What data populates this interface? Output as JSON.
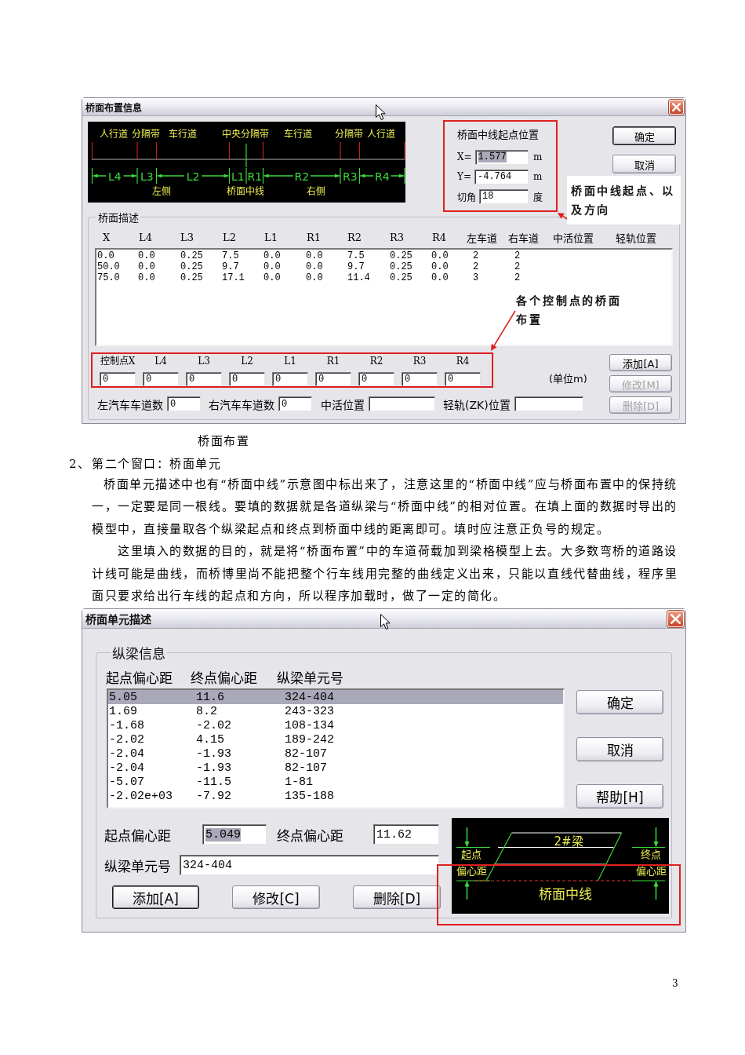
{
  "dialog_1": {
    "title": "桥面布置信息",
    "diagram": {
      "top_labels": [
        "人行道",
        "分隔带",
        "车行道",
        "中央分隔带",
        "车行道",
        "分隔带",
        "人行道"
      ],
      "dimension_labels": [
        "L4",
        "L3",
        "L2",
        "L1",
        "R1",
        "R2",
        "R3",
        "R4"
      ],
      "bottom_labels": [
        "左侧",
        "桥面中线",
        "右侧"
      ]
    },
    "origin": {
      "title": "桥面中线起点位置",
      "fields": [
        {
          "label": "X=",
          "value": "1.577",
          "unit": "m",
          "highlighted": true
        },
        {
          "label": "Y=",
          "value": "-4.764",
          "unit": "m",
          "highlighted": false
        },
        {
          "label": "切角",
          "value": "18",
          "unit": "度",
          "highlighted": false
        }
      ]
    },
    "buttons": [
      {
        "label": "确定",
        "default": true
      },
      {
        "label": "取消",
        "default": false
      }
    ],
    "origin_note": "桥面中线起点、以及方向",
    "description": {
      "title": "桥面描述",
      "columns": [
        "X",
        "L4",
        "L3",
        "L2",
        "L1",
        "R1",
        "R2",
        "R3",
        "R4",
        "左车道",
        "右车道",
        "中活位置",
        "轻轨位置"
      ],
      "rows": [
        [
          "0.0",
          "0.0",
          "0.25",
          "7.5",
          "0.0",
          "0.0",
          "7.5",
          "0.25",
          "0.0",
          "2",
          "2"
        ],
        [
          "50.0",
          "0.0",
          "0.25",
          "9.7",
          "0.0",
          "0.0",
          "9.7",
          "0.25",
          "0.0",
          "2",
          "2"
        ],
        [
          "75.0",
          "0.0",
          "0.25",
          "17.1",
          "0.0",
          "0.0",
          "11.4",
          "0.25",
          "0.0",
          "3",
          "2"
        ]
      ],
      "control_note": "各个控制点的桥面布置",
      "control_inputs": [
        {
          "label": "控制点X",
          "value": "0"
        },
        {
          "label": "L4",
          "value": "0"
        },
        {
          "label": "L3",
          "value": "0"
        },
        {
          "label": "L2",
          "value": "0"
        },
        {
          "label": "L1",
          "value": "0"
        },
        {
          "label": "R1",
          "value": "0"
        },
        {
          "label": "R2",
          "value": "0"
        },
        {
          "label": "R3",
          "value": "0"
        },
        {
          "label": "R4",
          "value": "0"
        }
      ],
      "unit_note": "(单位m)",
      "buttons": [
        {
          "label": "添加[A]",
          "disabled": false
        },
        {
          "label": "修改[M]",
          "disabled": true
        },
        {
          "label": "删除[D]",
          "disabled": true
        }
      ],
      "lane_fields": [
        {
          "label": "左汽车车道数",
          "value": "0"
        },
        {
          "label": "右汽车车道数",
          "value": "0"
        },
        {
          "label": "中活位置"
        },
        {
          "label": "轻轨(ZK)位置"
        }
      ]
    }
  },
  "caption": "桥面布置",
  "section": {
    "number": "2、",
    "title": "第二个窗口：桥面单元"
  },
  "paragraphs": [
    "桥面单元描述中也有“桥面中线”示意图中标出来了，注意这里的“桥面中线”应与桥面布置中的保持统一，一定要是同一根线。要填的数据就是各道纵梁与“桥面中线”的相对位置。在填上面的数据时导出的模型中，直接量取各个纵梁起点和终点到桥面中线的距离即可。填时应注意正负号的规定。",
    "这里填入的数据的目的，就是将“桥面布置”中的车道荷载加到梁格模型上去。大多数弯桥的道路设计线可能是曲线，而桥博里尚不能把整个行车线用完整的曲线定义出来，只能以直线代替曲线，程序里面只要求给出行车线的起点和方向，所以程序加载时，做了一定的简化。"
  ],
  "dialog_2": {
    "title": "桥面单元描述",
    "group_title": "纵梁信息",
    "columns": [
      "起点偏心距",
      "终点偏心距",
      "纵梁单元号"
    ],
    "rows": [
      {
        "cells": [
          "5.05",
          "11.6",
          "324-404"
        ],
        "selected": true
      },
      {
        "cells": [
          "1.69",
          "8.2",
          "243-323"
        ],
        "selected": false
      },
      {
        "cells": [
          "-1.68",
          "-2.02",
          "108-134"
        ],
        "selected": false
      },
      {
        "cells": [
          "-2.02",
          "4.15",
          "189-242"
        ],
        "selected": false
      },
      {
        "cells": [
          "-2.04",
          "-1.93",
          "82-107"
        ],
        "selected": false
      },
      {
        "cells": [
          "-2.04",
          "-1.93",
          "82-107"
        ],
        "selected": false
      },
      {
        "cells": [
          "-5.07",
          "-11.5",
          "1-81"
        ],
        "selected": false
      },
      {
        "cells": [
          "-2.02e+03",
          "-7.92",
          "135-188"
        ],
        "selected": false
      }
    ],
    "side_buttons": [
      {
        "label": "确定"
      },
      {
        "label": "取消"
      },
      {
        "label": "帮助[H]"
      }
    ],
    "fields": [
      {
        "label": "起点偏心距",
        "value": "5.049",
        "highlighted": true
      },
      {
        "label": "终点偏心距",
        "value": "11.62",
        "highlighted": false
      },
      {
        "label": "纵梁单元号",
        "value": "324-404",
        "highlighted": false
      }
    ],
    "action_buttons": [
      {
        "label": "添加[A]",
        "default": true
      },
      {
        "label": "修改[C]",
        "default": false
      },
      {
        "label": "删除[D]",
        "default": false
      }
    ],
    "diagram": {
      "beam_label": "2#梁",
      "start_label": [
        "起点",
        "偏心距"
      ],
      "end_label": [
        "终点",
        "偏心距"
      ],
      "centerline_label": "桥面中线"
    }
  },
  "page_number": "3"
}
